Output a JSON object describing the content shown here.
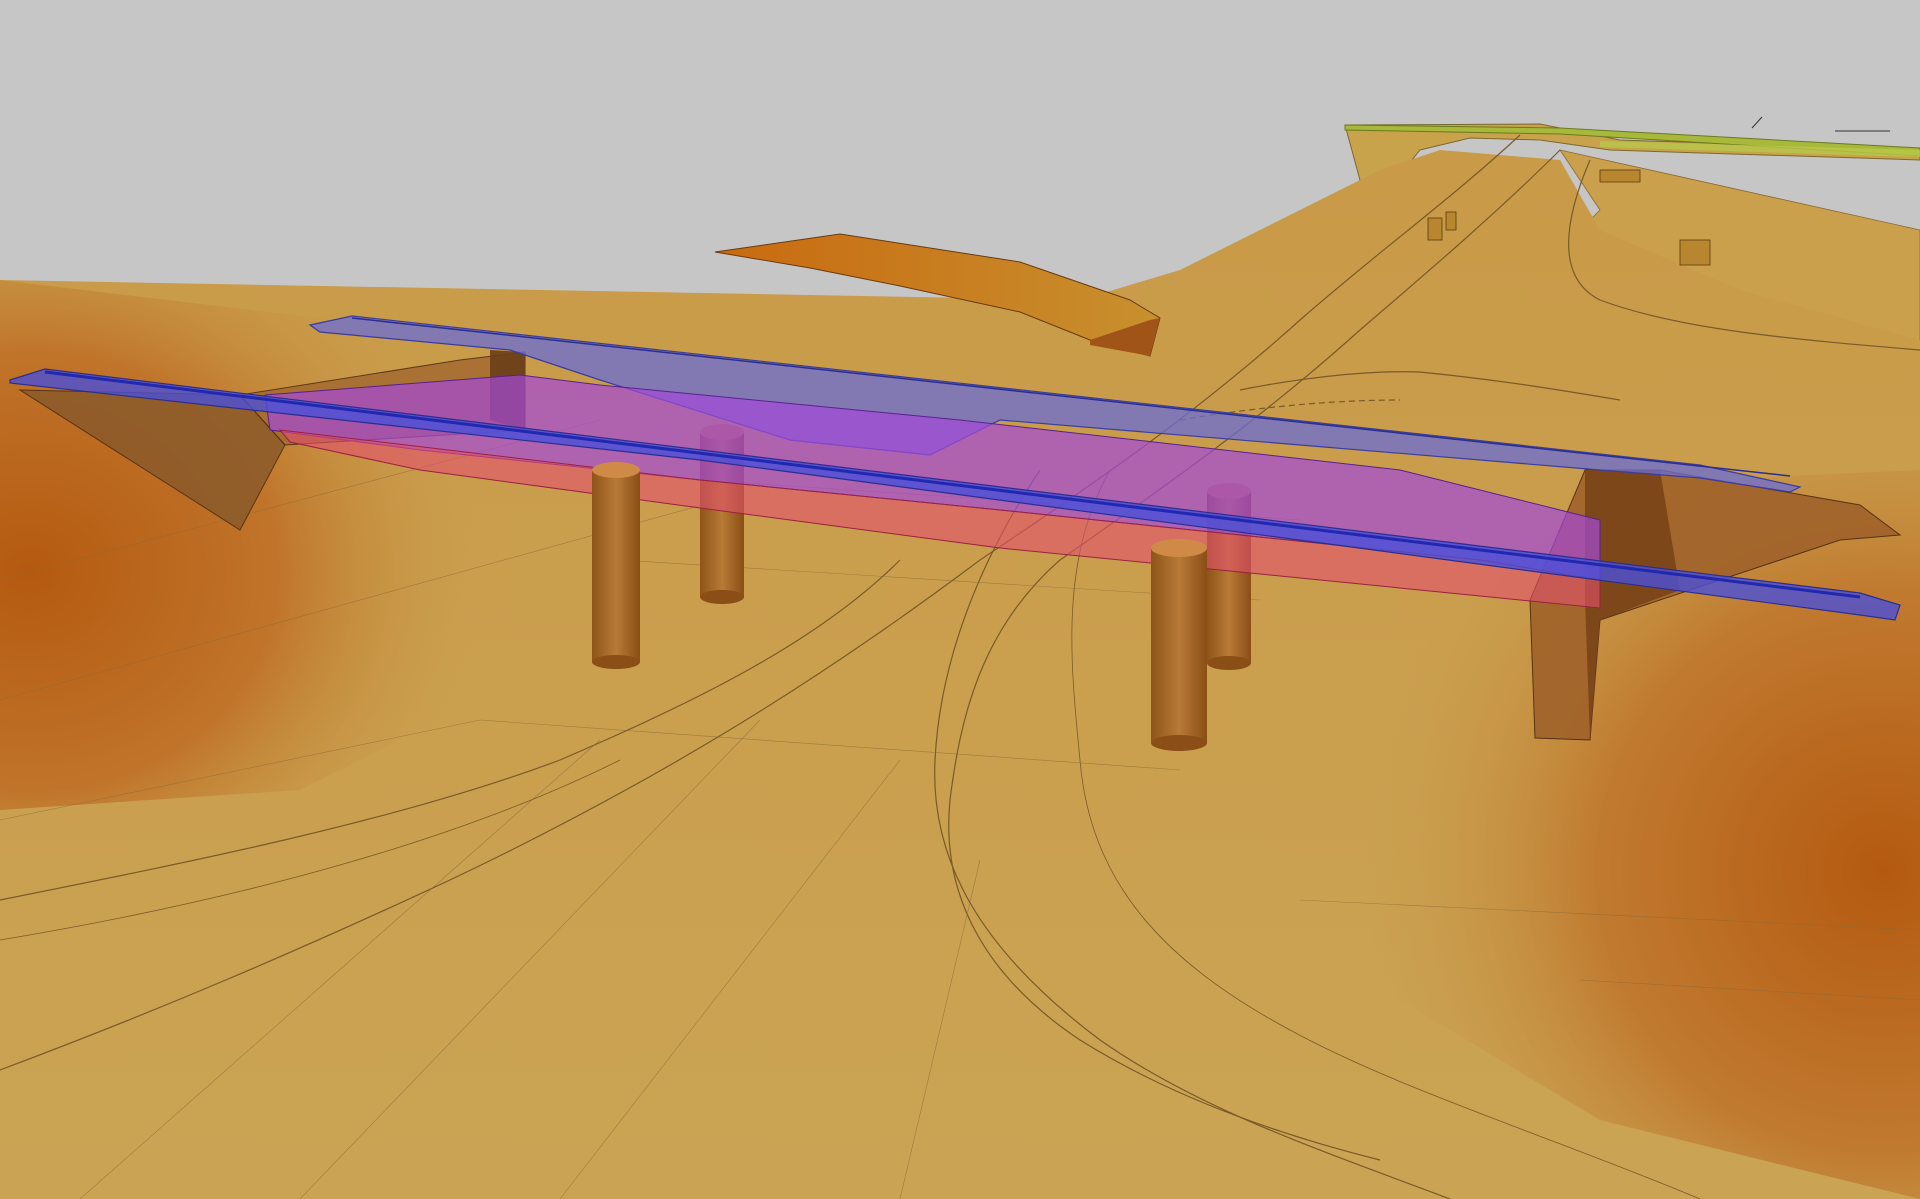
{
  "scene": {
    "colors": {
      "sky": "#c6c6c6",
      "terrain_light": "#c9a04e",
      "terrain_mid": "#c88a3a",
      "terrain_dark": "#b75d12",
      "road_edge": "#8a6a30",
      "deck_blue": "#6a6ed6",
      "deck_violet": "#a448d8",
      "deck_pink": "#e2506e",
      "column": "#9a5a1c",
      "vegetation": "#a8b83a"
    },
    "elements": [
      "terrain",
      "roadway",
      "ramp",
      "bridge-deck-upper",
      "bridge-deck-middle",
      "bridge-deck-lower",
      "pier-column",
      "abutment",
      "vegetation-strip"
    ]
  }
}
